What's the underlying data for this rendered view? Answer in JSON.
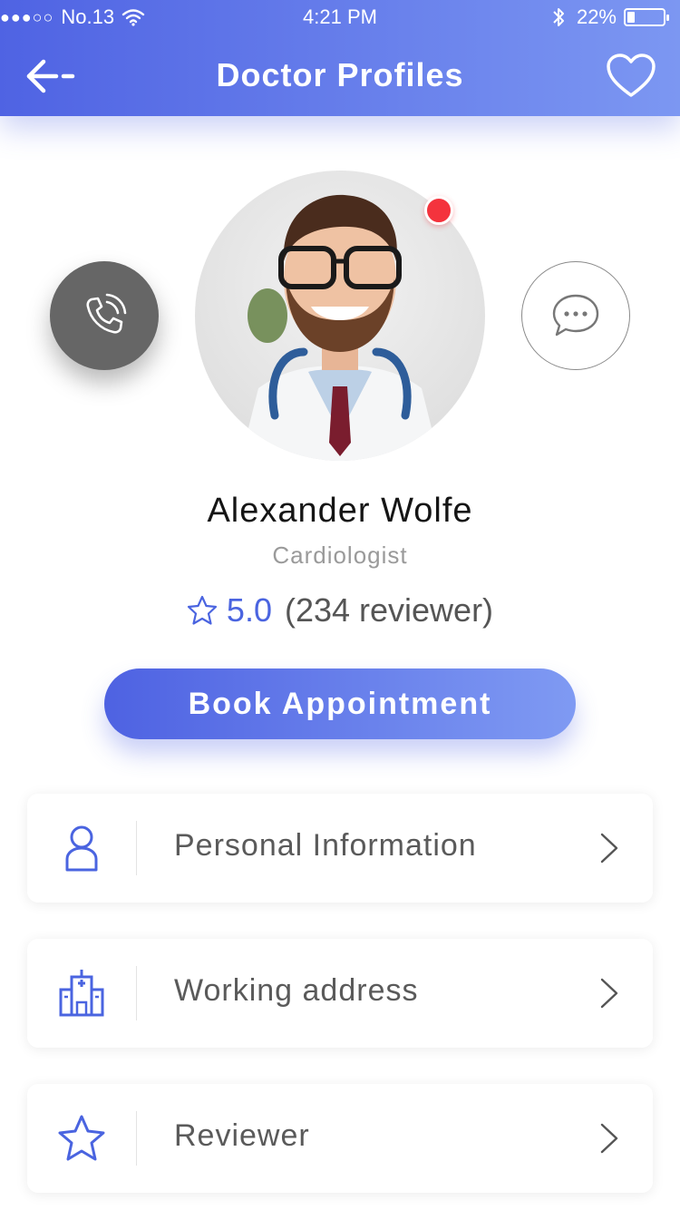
{
  "status_bar": {
    "signal": "●●●○○",
    "carrier": "No.13",
    "time": "4:21 PM",
    "battery": "22%",
    "battery_level": 0.22
  },
  "header": {
    "title": "Doctor Profiles",
    "back_icon": "arrow-left-icon",
    "favorite_icon": "heart-outline-icon"
  },
  "doctor": {
    "name": "Alexander Wolfe",
    "specialty": "Cardiologist",
    "rating": "5.0",
    "reviews": "(234 reviewer)",
    "online": true
  },
  "actions": {
    "call_icon": "phone-call-icon",
    "message_icon": "chat-bubble-icon",
    "book_label": "Book Appointment"
  },
  "menu": [
    {
      "label": "Personal Information",
      "icon": "user-icon"
    },
    {
      "label": "Working address",
      "icon": "hospital-icon"
    },
    {
      "label": "Reviewer",
      "icon": "star-icon"
    }
  ],
  "colors": {
    "accent": "#4f63e3",
    "accent_light": "#7c97f2",
    "status_dot": "#f4333d",
    "call_button": "#666666"
  }
}
